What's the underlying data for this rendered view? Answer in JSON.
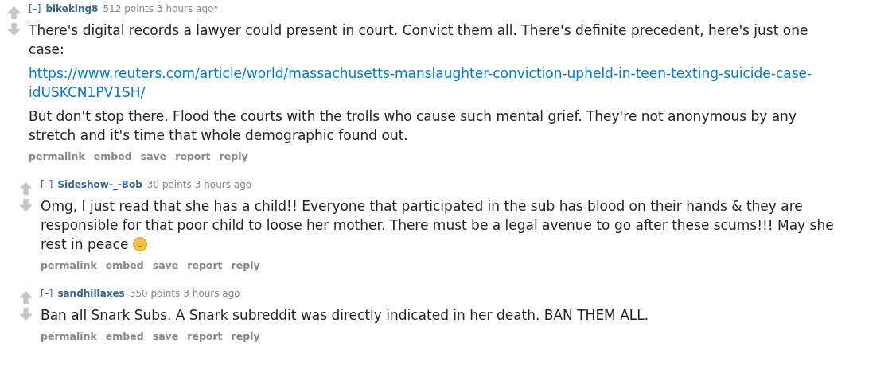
{
  "comments": [
    {
      "collapse": "[–]",
      "author": "bikeking8",
      "points": "512 points",
      "time": "3 hours ago*",
      "paragraphs": [
        {
          "kind": "text",
          "text": "There's digital records a lawyer could present in court. Convict them all. There's definite precedent, here's just one case:"
        },
        {
          "kind": "link",
          "text": "https://www.reuters.com/article/world/massachusetts-manslaughter-conviction-upheld-in-teen-texting-suicide-case-idUSKCN1PV1SH/"
        },
        {
          "kind": "text",
          "text": "But don't stop there. Flood the courts with the trolls who cause such mental grief. They're not anonymous by any stretch and it's time that whole demographic found out."
        }
      ],
      "actions": [
        "permalink",
        "embed",
        "save",
        "report",
        "reply"
      ],
      "children": [
        {
          "collapse": "[–]",
          "author": "Sideshow-_-Bob",
          "points": "30 points",
          "time": "3 hours ago",
          "paragraphs": [
            {
              "kind": "text",
              "text": "Omg, I just read that she has a child!! Everyone that participated in the sub has blood on their hands & they are responsible for that poor child to loose her mother. There must be a legal avenue to go after these scums!!! May she rest in peace",
              "emoji": true
            }
          ],
          "actions": [
            "permalink",
            "embed",
            "save",
            "report",
            "reply"
          ]
        },
        {
          "collapse": "[–]",
          "author": "sandhillaxes",
          "points": "350 points",
          "time": "3 hours ago",
          "paragraphs": [
            {
              "kind": "text",
              "text": "Ban all Snark Subs. A Snark subreddit was directly indicated in her death. BAN THEM ALL."
            }
          ],
          "actions": [
            "permalink",
            "embed",
            "save",
            "report",
            "reply"
          ]
        }
      ]
    }
  ]
}
